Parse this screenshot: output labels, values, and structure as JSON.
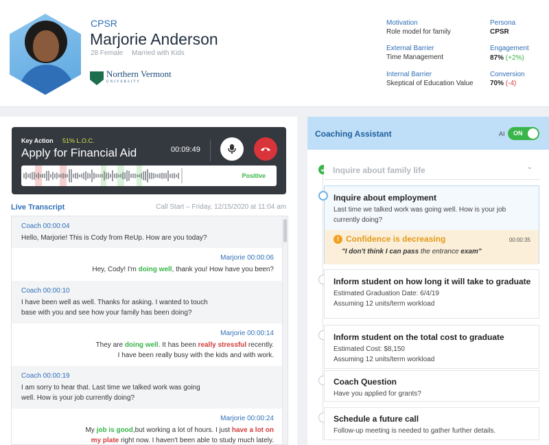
{
  "profile": {
    "segment": "CPSR",
    "name": "Marjorie Anderson",
    "age_gender": "28 Female",
    "household": "Married with Kids",
    "school_name": "Northern Vermont",
    "school_sub": "UNIVERSITY",
    "stats": {
      "motivation_label": "Motivation",
      "motivation_value": "Role model for family",
      "external_label": "External Barrier",
      "external_value": "Time Management",
      "internal_label": "Internal Barrier",
      "internal_value": "Skeptical of Education Value",
      "persona_label": "Persona",
      "persona_value": "CPSR",
      "engagement_label": "Engagement",
      "engagement_value": "87%",
      "engagement_delta": "(+2%)",
      "conversion_label": "Conversion",
      "conversion_value": "70%",
      "conversion_delta": "(-4)"
    }
  },
  "call": {
    "key_action_label": "Key Action",
    "loc": "51% L.O.C.",
    "action_title": "Apply for Financial Aid",
    "timer": "00:09:49",
    "sentiment": "Positive"
  },
  "transcript": {
    "title": "Live Transcript",
    "call_start": "Call Start – Friday, 12/15/2020 at 11:04 am",
    "messages": [
      {
        "speaker": "Coach 00:00:04",
        "text": "Hello, Marjorie! This is Cody from ReUp. How are you today?"
      },
      {
        "speaker": "Marjorie 00:00:06",
        "t1": "Hey, Cody! I'm ",
        "g1": "doing well",
        "t2": ", thank you! How have you been?"
      },
      {
        "speaker": "Coach 00:00:10",
        "line1": "I have been well as well. Thanks for asking. I wanted to touch",
        "line2": "base with you and see how your family has been doing?"
      },
      {
        "speaker": "Marjorie 00:00:14",
        "t1": "They are ",
        "g1": "doing well",
        "t2": ". It has been ",
        "r1": "really stressful",
        "t3": " recently.",
        "line2": "I have been really busy with the kids and with work."
      },
      {
        "speaker": "Coach 00:00:19",
        "line1": "I am sorry to hear that. Last time we talked work was going",
        "line2": "well. How is your job currently doing?"
      },
      {
        "speaker": "Marjorie 00:00:24",
        "t1": "My ",
        "g1": "job is good",
        "t2": ",but working a lot of hours. I just ",
        "r1": "have a lot on",
        "r2": "my plate",
        "t3": " right now. I haven't been able to study much lately."
      }
    ]
  },
  "assistant": {
    "title": "Coaching Assistant",
    "ai_label": "AI",
    "toggle_label": "ON",
    "steps": [
      {
        "title": "Inquire about family life"
      },
      {
        "title": "Inquire about employment",
        "sub1": "Last time we talked work was going well. How is your job",
        "sub2": "currently doing?"
      },
      {
        "title": "Inform student on how long it will take to graduate",
        "sub1": "Estimated Graduation Date: 6/4/19",
        "sub2": "Assuming 12 units/term workload"
      },
      {
        "title": "Inform student on the total cost to graduate",
        "sub1": "Estimated Cost: $8,150",
        "sub2": "Assuming 12 units/term workload"
      },
      {
        "title": "Coach Question",
        "sub1": "Have you applied for grants?"
      },
      {
        "title": "Schedule a future call",
        "sub1": "Follow-up meeting is needed to gather further details."
      }
    ],
    "confidence": {
      "title": "Confidence is decreasing",
      "time": "00:00:35",
      "quote_bold": "\"I don't think I can pass",
      "quote_rest": " the entrance ",
      "quote_end": "exam\""
    }
  },
  "colors": {
    "accent": "#2f6fb7",
    "positive": "#39b54a",
    "negative": "#d23b3b",
    "warning": "#e39a17"
  }
}
